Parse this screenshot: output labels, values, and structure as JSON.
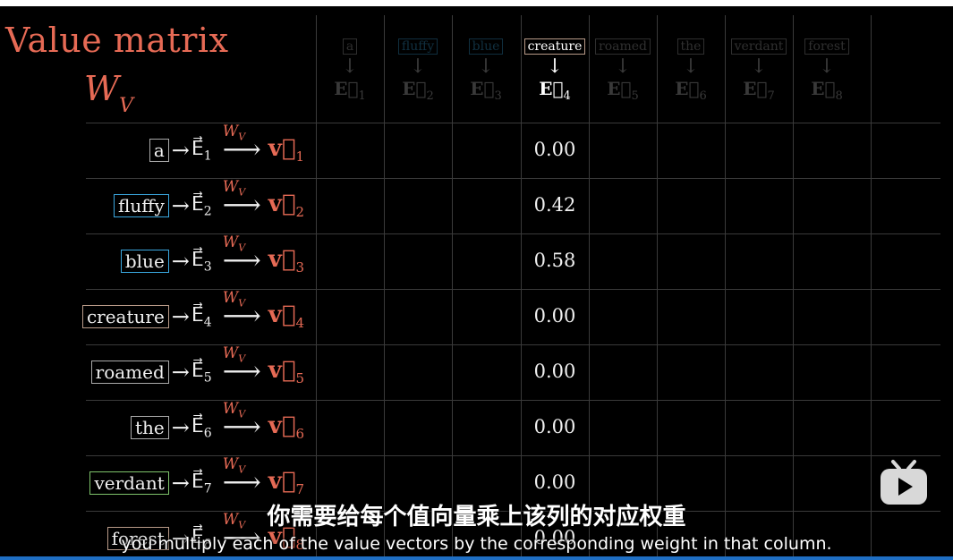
{
  "title": "Value matrix",
  "matrix_symbol": "W",
  "matrix_subscript": "V",
  "columns": [
    {
      "word": "a",
      "vec": "E",
      "index": "1",
      "color": "#aaaaaa",
      "highlighted": false
    },
    {
      "word": "fluffy",
      "vec": "E",
      "index": "2",
      "color": "#3aa8e0",
      "highlighted": false
    },
    {
      "word": "blue",
      "vec": "E",
      "index": "3",
      "color": "#3aa8e0",
      "highlighted": false
    },
    {
      "word": "creature",
      "vec": "E",
      "index": "4",
      "color": "#b89a88",
      "highlighted": true
    },
    {
      "word": "roamed",
      "vec": "E",
      "index": "5",
      "color": "#aaaaaa",
      "highlighted": false
    },
    {
      "word": "the",
      "vec": "E",
      "index": "6",
      "color": "#aaaaaa",
      "highlighted": false
    },
    {
      "word": "verdant",
      "vec": "E",
      "index": "7",
      "color": "#aaaaaa",
      "highlighted": false
    },
    {
      "word": "forest",
      "vec": "E",
      "index": "8",
      "color": "#aaaaaa",
      "highlighted": false
    }
  ],
  "rows": [
    {
      "word": "a",
      "color": "#aaaaaa",
      "index": "1",
      "value": "0.00"
    },
    {
      "word": "fluffy",
      "color": "#3aa8e0",
      "index": "2",
      "value": "0.42"
    },
    {
      "word": "blue",
      "color": "#3aa8e0",
      "index": "3",
      "value": "0.58"
    },
    {
      "word": "creature",
      "color": "#b89a88",
      "index": "4",
      "value": "0.00"
    },
    {
      "word": "roamed",
      "color": "#aaaaaa",
      "index": "5",
      "value": "0.00"
    },
    {
      "word": "the",
      "color": "#aaaaaa",
      "index": "6",
      "value": "0.00"
    },
    {
      "word": "verdant",
      "color": "#7ec36b",
      "index": "7",
      "value": "0.00"
    },
    {
      "word": "forest",
      "color": "#b89a88",
      "index": "8",
      "value": "0.00"
    }
  ],
  "symbols": {
    "embedding": "E",
    "value": "v",
    "map_label": "W",
    "map_label_sub": "V"
  },
  "subtitles": {
    "chinese": "你需要给每个值向量乘上该列的对应权重",
    "english": "you multiply each of the value vectors by the corresponding weight in that column."
  },
  "accent_color": "#e66a55",
  "logo_icon": "bilibili-tv-logo"
}
